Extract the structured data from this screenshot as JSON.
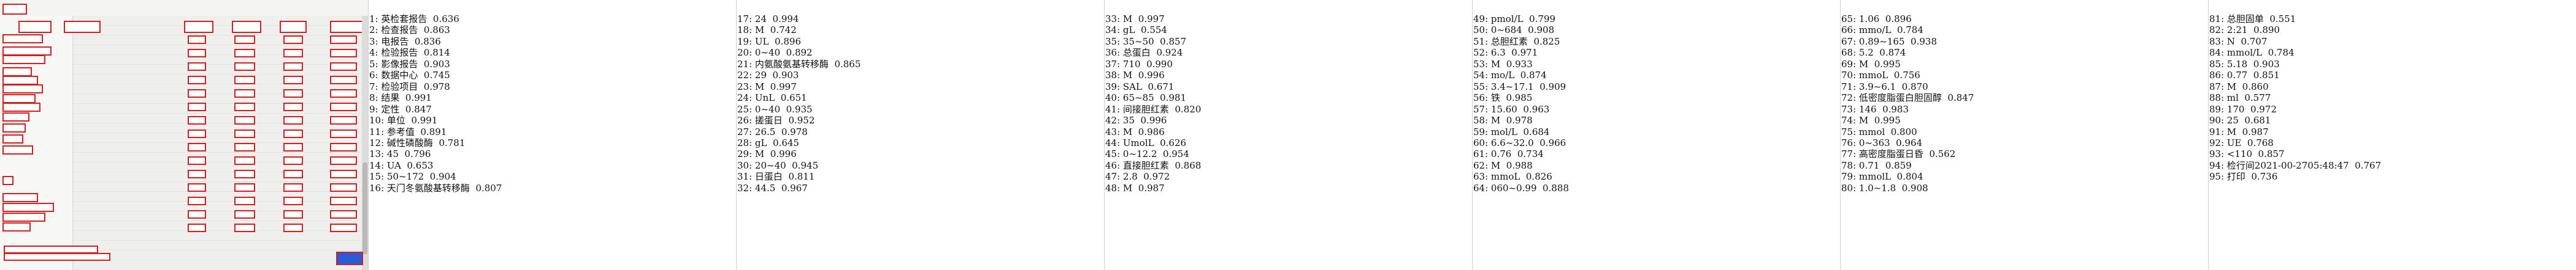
{
  "columns": [
    [
      "1: 英检套报告  0.636",
      "2: 检查报告  0.863",
      "3: 电报告  0.836",
      "4: 检验报告  0.814",
      "5: 影像报告  0.903",
      "6: 数据中心  0.745",
      "7: 检验项目  0.978",
      "8: 结果  0.991",
      "9: 定性  0.847",
      "10: 单位  0.991",
      "11: 参考值  0.891",
      "12: 碱性磷酸酶  0.781",
      "13: 45  0.796",
      "14: UA  0.653",
      "15: 50~172  0.904",
      "16: 天门冬氨酸基转移酶  0.807"
    ],
    [
      "17: 24  0.994",
      "18: M  0.742",
      "19: UL  0.896",
      "20: 0~40  0.892",
      "21: 内氨酸氨基转移酶  0.865",
      "22: 29  0.903",
      "23: M  0.997",
      "24: UnL  0.651",
      "25: 0~40  0.935",
      "26: 搓蛋日  0.952",
      "27: 26.5  0.978",
      "28: gL  0.645",
      "29: M  0.996",
      "30: 20~40  0.945",
      "31: 日蛋白  0.811",
      "32: 44.5  0.967"
    ],
    [
      "33: M  0.997",
      "34: gL  0.554",
      "35: 35~50  0.857",
      "36: 总蛋白  0.924",
      "37: 710  0.990",
      "38: M  0.996",
      "39: SAL  0.671",
      "40: 65~85  0.981",
      "41: 间接胆红素  0.820",
      "42: 35  0.996",
      "43: M  0.986",
      "44: UmolL  0.626",
      "45: 0~12.2  0.954",
      "46: 直接胆红素  0.868",
      "47: 2.8  0.972",
      "48: M  0.987"
    ],
    [
      "49: pmol/L  0.799",
      "50: 0~684  0.908",
      "51: 总胆红素  0.825",
      "52: 6.3  0.971",
      "53: M  0.933",
      "54: mo/L  0.874",
      "55: 3.4~17.1  0.909",
      "56: 铁  0.985",
      "57: 15.60  0.963",
      "58: M  0.978",
      "59: mol/L  0.684",
      "60: 6.6~32.0  0.966",
      "61: 0.76  0.734",
      "62: M  0.988",
      "63: mmoL  0.826",
      "64: 060~0.99  0.888"
    ],
    [
      "65: 1.06  0.896",
      "66: mmo/L  0.784",
      "67: 0.89~165  0.938",
      "68: 5.2  0.874",
      "69: M  0.995",
      "70: mmoL  0.756",
      "71: 3.9~6.1  0.870",
      "72: 低密度脂蛋白胆固醇  0.847",
      "73: 146  0.983",
      "74: M  0.995",
      "75: mmol  0.800",
      "76: 0~363  0.964",
      "77: 高密度脂蛋日昏  0.562",
      "78: 0.71  0.859",
      "79: mmolL  0.804",
      "80: 1.0~1.8  0.908"
    ],
    [
      "81: 总胆固单  0.551",
      "82: 2:21  0.890",
      "83: N  0.707",
      "84: mmol/L  0.784",
      "85: 5.18  0.903",
      "86: 0.77  0.851",
      "87: M  0.860",
      "88: ml  0.577",
      "89: 170  0.972",
      "90: 25  0.681",
      "91: M  0.987",
      "92: UE  0.768",
      "93: <110  0.857",
      "94: 检行间2021-00-2705:48:47  0.767",
      "95: 打印  0.736"
    ]
  ],
  "colors": {
    "box": "#d21e1e",
    "button": "#2a5bd7"
  }
}
